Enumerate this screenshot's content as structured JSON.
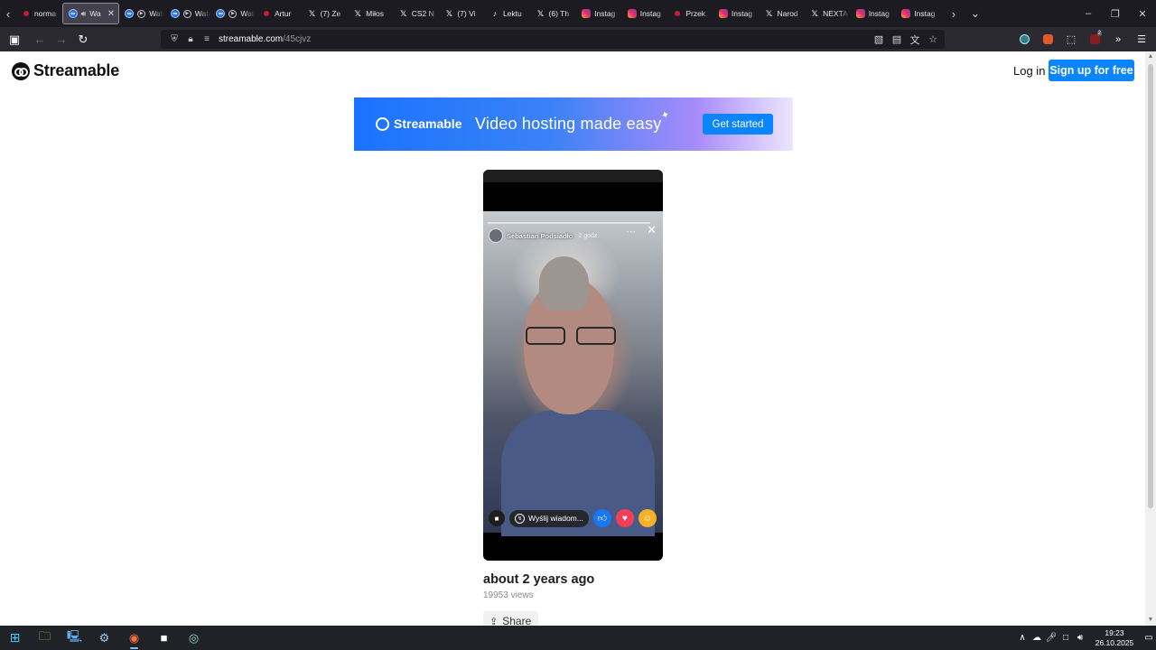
{
  "browser": {
    "tabs": [
      {
        "label": "norma",
        "fav": "yt",
        "icon": "youtube-icon"
      },
      {
        "label": "Wa",
        "fav": "st",
        "icon": "streamable-icon",
        "active": true
      },
      {
        "label": "Watch",
        "fav": "st",
        "icon": "streamable-icon",
        "play": true
      },
      {
        "label": "Watch",
        "fav": "st",
        "icon": "streamable-icon",
        "play": true
      },
      {
        "label": "Watch",
        "fav": "st",
        "icon": "streamable-icon",
        "play": true
      },
      {
        "label": "Artur",
        "fav": "yt",
        "icon": "youtube-icon"
      },
      {
        "label": "(7) Ze",
        "fav": "x",
        "icon": "x-icon"
      },
      {
        "label": "Miłos",
        "fav": "x",
        "icon": "x-icon"
      },
      {
        "label": "CS2 N",
        "fav": "cs",
        "icon": "cs2-icon"
      },
      {
        "label": "(7) Vi",
        "fav": "x",
        "icon": "x-icon"
      },
      {
        "label": "Lektu",
        "fav": "tt",
        "icon": "tiktok-icon"
      },
      {
        "label": "(6) Th",
        "fav": "x",
        "icon": "x-icon"
      },
      {
        "label": "Instag",
        "fav": "ig",
        "icon": "instagram-icon"
      },
      {
        "label": "Instag",
        "fav": "ig",
        "icon": "instagram-icon"
      },
      {
        "label": "Przek",
        "fav": "yt",
        "icon": "youtube-icon"
      },
      {
        "label": "Instag",
        "fav": "ig",
        "icon": "instagram-icon"
      },
      {
        "label": "Narod",
        "fav": "x",
        "icon": "x-icon"
      },
      {
        "label": "NEXTA",
        "fav": "x",
        "icon": "x-icon"
      },
      {
        "label": "Instag",
        "fav": "ig",
        "icon": "instagram-icon"
      },
      {
        "label": "Instag",
        "fav": "ig",
        "icon": "instagram-icon"
      }
    ],
    "url_host": "streamable.com",
    "url_path": "/45cjvz",
    "extension_badge": "2"
  },
  "site": {
    "logo_text": "Streamable",
    "login_label": "Log in",
    "signup_label": "Sign up for free"
  },
  "banner": {
    "logo_text": "Streamable",
    "tagline": "Video hosting made easy",
    "cta_label": "Get started"
  },
  "video": {
    "story_author": "Sebastian Podsiadło",
    "story_time": "2 godz.",
    "message_placeholder": "Wyślij wiadom..."
  },
  "meta": {
    "posted": "about 2 years ago",
    "views": "19953 views",
    "share_label": "Share"
  },
  "taskbar": {
    "time": "19:23",
    "date": "26.10.2025"
  }
}
